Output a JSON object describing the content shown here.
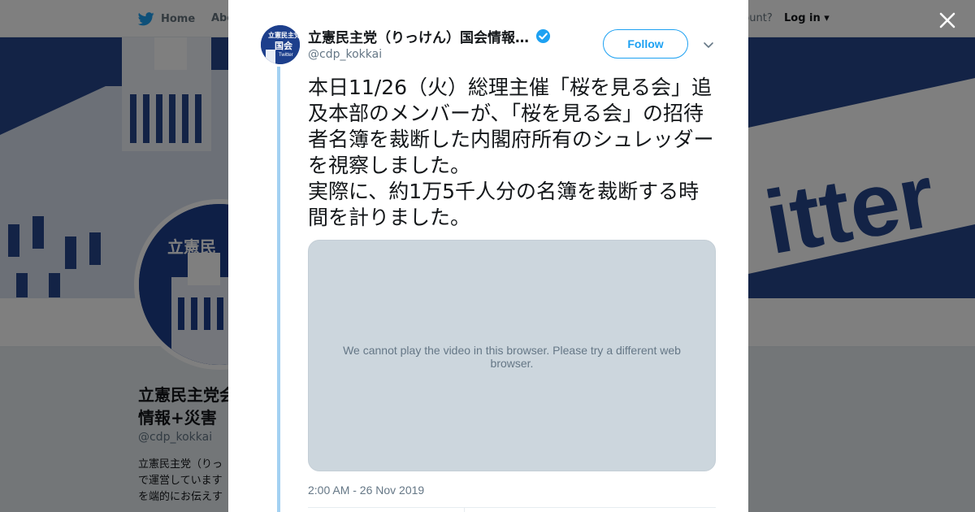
{
  "header": {
    "home_label": "Home",
    "about_label": "Abo",
    "account_prompt": "ccount?",
    "login_label": "Log in"
  },
  "profile": {
    "name": "立憲民主党会情報+災害",
    "handle": "@cdp_kokkai",
    "bio": "立憲民主党（りっで運営していますを端的にお伝えす"
  },
  "tweet": {
    "author_name": "立憲民主党（りっけん）国会情報…",
    "author_handle": "@cdp_kokkai",
    "follow_label": "Follow",
    "text_line1": "本日11/26（火）総理主催「桜を見る会」追及本部のメンバーが、「桜を見る会」の招待者名簿を裁断した内閣府所有のシュレッダーを視察しました。",
    "text_line2": "実際に、約1万5千人分の名簿を裁断する時間を計りました。",
    "video_message": "We cannot play the video in this browser. Please try a different web browser.",
    "timestamp": "2:00 AM - 26 Nov 2019"
  },
  "icons": {
    "bird": "twitter-bird-icon",
    "verified": "verified-badge-icon",
    "caret": "chevron-down-icon",
    "close": "close-icon"
  },
  "colors": {
    "twitter_blue": "#1da1f2",
    "party_blue": "#1d3f8c",
    "thread_line": "#a3d1f2"
  }
}
